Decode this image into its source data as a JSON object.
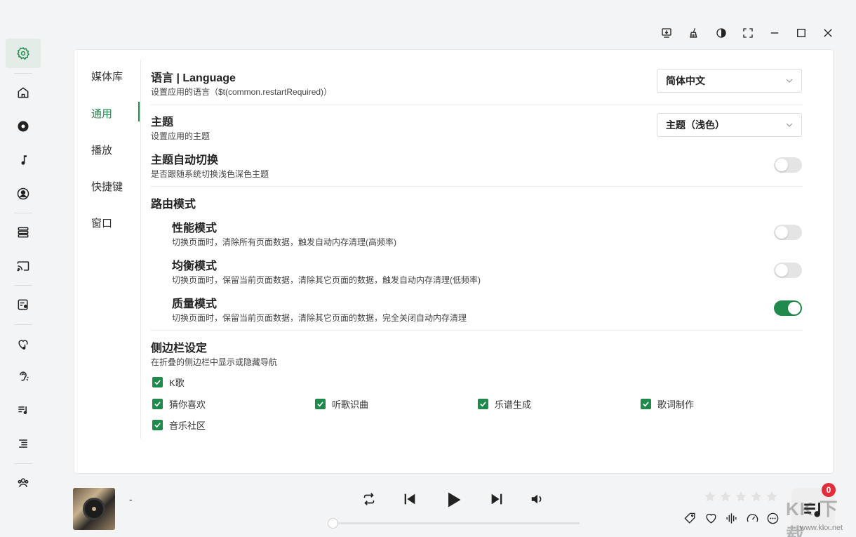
{
  "sidebar": {
    "items": [
      {
        "name": "settings-icon",
        "active": true
      },
      {
        "name": "home-icon"
      },
      {
        "name": "disc-icon"
      },
      {
        "name": "music-note-icon"
      },
      {
        "name": "user-icon"
      },
      {
        "name": "library-icon"
      },
      {
        "name": "cast-icon"
      },
      {
        "name": "lyrics-mic-icon"
      },
      {
        "name": "heart-music-icon"
      },
      {
        "name": "listen-recognize-icon"
      },
      {
        "name": "playlist-icon"
      },
      {
        "name": "queue-list-icon"
      },
      {
        "name": "community-icon"
      }
    ]
  },
  "window_controls": [
    "download-tray-icon",
    "clean-broom-icon",
    "theme-contrast-icon",
    "fullscreen-icon",
    "minimize-icon",
    "maximize-icon",
    "close-icon"
  ],
  "settings_nav": {
    "items": [
      "媒体库",
      "通用",
      "播放",
      "快捷键",
      "窗口"
    ],
    "active_index": 1
  },
  "language": {
    "title": "语言 | Language",
    "desc": "设置应用的语言（$t(common.restartRequired)）",
    "value": "简体中文"
  },
  "theme": {
    "title": "主题",
    "desc": "设置应用的主题",
    "value": "主题（浅色）"
  },
  "theme_auto": {
    "title": "主题自动切换",
    "desc": "是否跟随系统切换浅色深色主题",
    "enabled": false
  },
  "route_mode": {
    "title": "路由模式",
    "options": [
      {
        "title": "性能模式",
        "desc": "切换页面时，清除所有页面数据，触发自动内存清理(高频率)",
        "enabled": false
      },
      {
        "title": "均衡模式",
        "desc": "切换页面时，保留当前页面数据，清除其它页面的数据，触发自动内存清理(低频率)",
        "enabled": false
      },
      {
        "title": "质量模式",
        "desc": "切换页面时，保留当前页面数据，清除其它页面的数据，完全关闭自动内存清理",
        "enabled": true
      }
    ]
  },
  "sidebar_settings": {
    "title": "侧边栏设定",
    "desc": "在折叠的侧边栏中显示或隐藏导航",
    "checkboxes": [
      {
        "label": "K歌",
        "checked": true
      },
      {
        "label": "猜你喜欢",
        "checked": true
      },
      {
        "label": "听歌识曲",
        "checked": true
      },
      {
        "label": "乐谱生成",
        "checked": true
      },
      {
        "label": "歌词制作",
        "checked": true
      },
      {
        "label": "音乐社区",
        "checked": true
      }
    ]
  },
  "player": {
    "title": "-",
    "progress": 0.0,
    "rating": 0,
    "queue_count": "0"
  },
  "watermark": {
    "text": "KK 下载",
    "url": "www.kkx.net"
  },
  "colors": {
    "accent": "#1f8a4c",
    "badge": "#e22d3a"
  }
}
